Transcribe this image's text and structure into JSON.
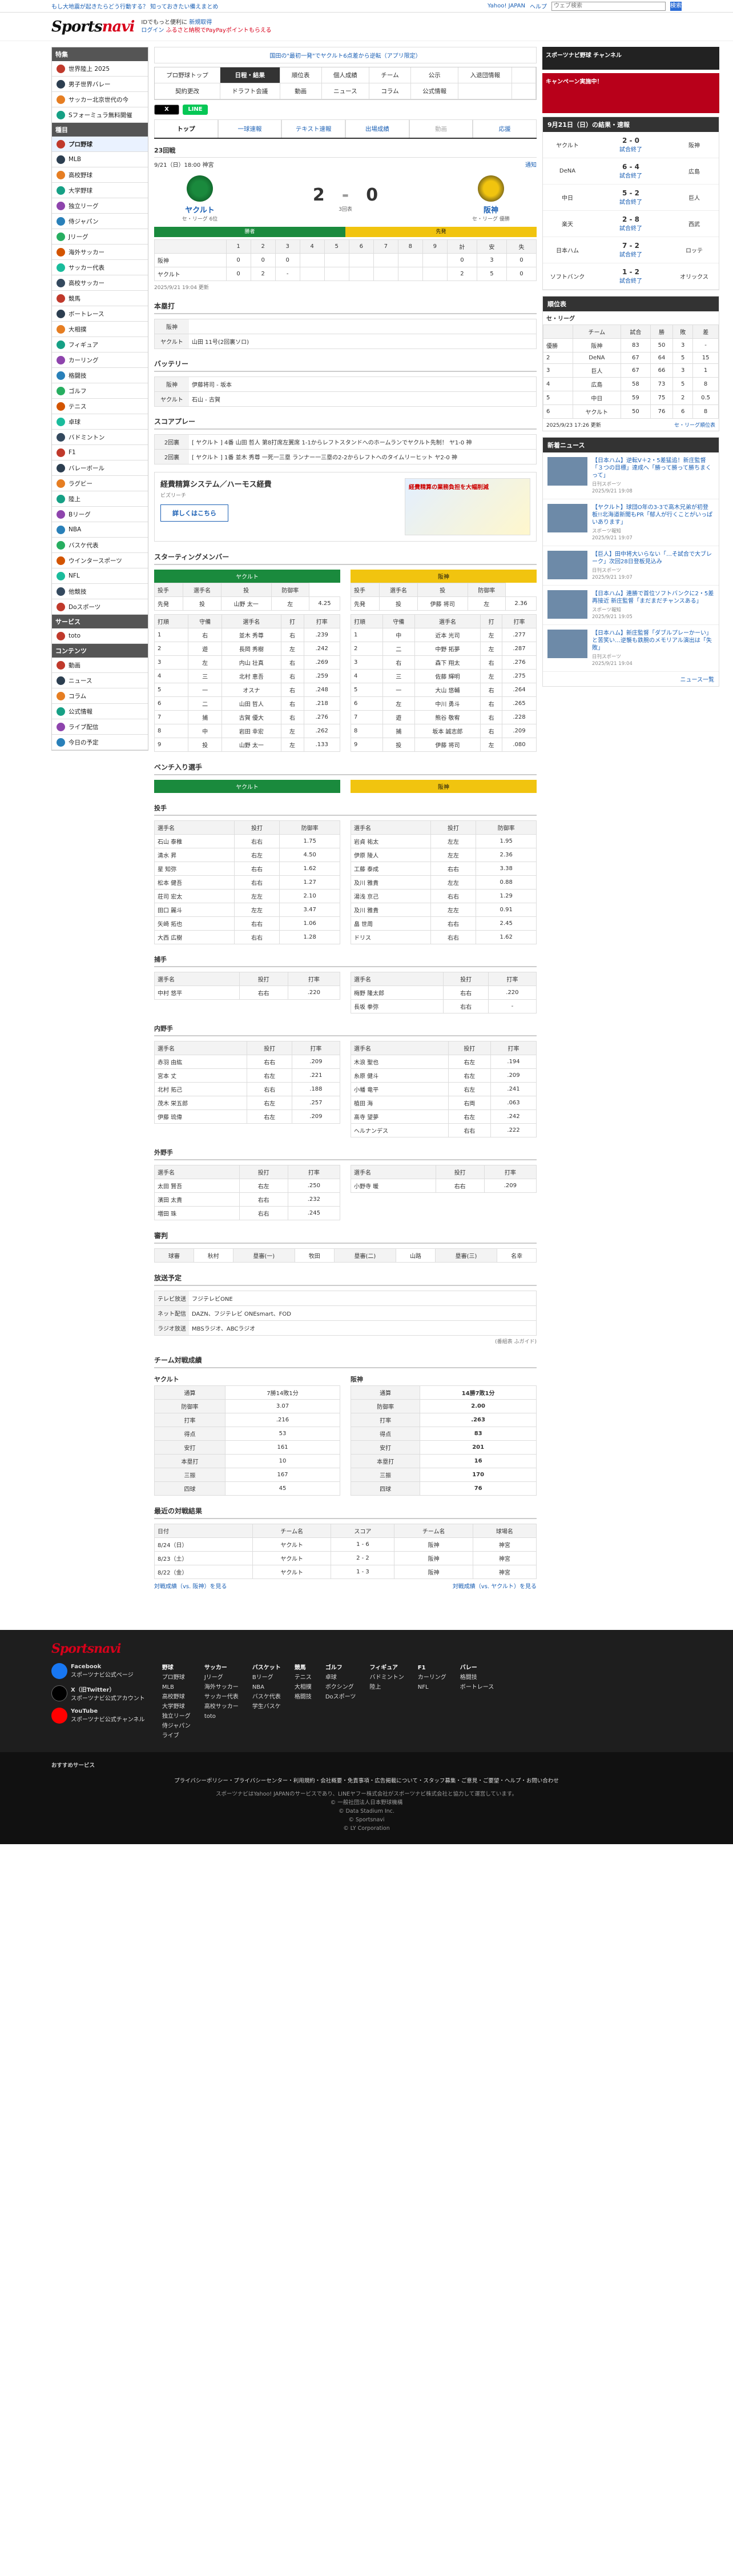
{
  "topbar": {
    "alert": "もし大地震が起きたらどう行動する？ 知っておきたい備えまとめ",
    "yahoo": "Yahoo! JAPAN",
    "help": "ヘルプ",
    "search_placeholder": "ウェブ検索",
    "search_btn": "検索"
  },
  "header": {
    "logo_a": "Sports",
    "logo_b": "navi",
    "line1a": "IDでもっと便利に",
    "line1b": "新規取得",
    "line2a": "ログイン",
    "line2b": "ふるさと納税でPayPayポイントもらえる"
  },
  "lnav": {
    "special": "特集",
    "sp_items": [
      "世界陸上 2025",
      "男子世界バレー",
      "サッカー北京世代の今",
      "Sフォーミュラ無料開催"
    ],
    "sport": "種目",
    "items": [
      "プロ野球",
      "MLB",
      "高校野球",
      "大学野球",
      "独立リーグ",
      "侍ジャパン",
      "Jリーグ",
      "海外サッカー",
      "サッカー代表",
      "高校サッカー",
      "競馬",
      "ボートレース",
      "大相撲",
      "フィギュア",
      "カーリング",
      "格闘技",
      "ゴルフ",
      "テニス",
      "卓球",
      "バドミントン",
      "F1",
      "バレーボール",
      "ラグビー",
      "陸上",
      "Bリーグ",
      "NBA",
      "バスケ代表",
      "ウインタースポーツ",
      "NFL",
      "他競技",
      "Doスポーツ"
    ],
    "service": "サービス",
    "svc_items": [
      "toto"
    ],
    "content": "コンテンツ",
    "cnt_items": [
      "動画",
      "ニュース",
      "コラム",
      "公式情報",
      "ライブ配信",
      "今日の予定"
    ]
  },
  "crumb": "国田の\"最初一発\"でヤクルト6点差から逆転（アプリ限定）",
  "subnav": [
    "プロ野球トップ",
    "日程・結果",
    "順位表",
    "個人成績",
    "チーム",
    "公示",
    "入退団情報",
    "",
    "契約更改",
    "ドラフト会議",
    "動画",
    "ニュース",
    "コラム",
    "公式情報",
    "",
    ""
  ],
  "share": [
    "X",
    "LINE"
  ],
  "gametabs": [
    "トップ",
    "一球速報",
    "テキスト速報",
    "出場成績",
    "動画",
    "応援"
  ],
  "game": {
    "round": "23回戦",
    "date": "9/21（日）18:00 神宮",
    "notify": "通知",
    "home": "ヤクルト",
    "home_sub": "セ・リーグ 6位",
    "away": "阪神",
    "away_sub": "セ・リーグ 優勝",
    "hs": "2",
    "as": "0",
    "phase": "試合終了",
    "result": "3回表",
    "win": "勝者",
    "lose": "先発",
    "lineH": [
      "",
      "1",
      "2",
      "3",
      "4",
      "5",
      "6",
      "7",
      "8",
      "9",
      "計",
      "安",
      "失"
    ],
    "lineA": [
      "阪神",
      "0",
      "0",
      "0",
      "",
      "",
      "",
      "",
      "",
      "",
      "0",
      "3",
      "0"
    ],
    "lineY": [
      "ヤクルト",
      "0",
      "2",
      "-",
      "",
      "",
      "",
      "",
      "",
      "",
      "2",
      "5",
      "0"
    ],
    "updated": "2025/9/21 19:04 更新"
  },
  "hr": {
    "title": "本塁打",
    "rows": [
      {
        "t": "阪神",
        "v": ""
      },
      {
        "t": "ヤクルト",
        "v": "山田 11号(2回裏ソロ)"
      }
    ]
  },
  "battery": {
    "title": "バッテリー",
    "rows": [
      {
        "t": "阪神",
        "v": "伊藤将司 - 坂本"
      },
      {
        "t": "ヤクルト",
        "v": "石山 - 古賀"
      }
    ]
  },
  "scoreplay": {
    "title": "スコアプレー",
    "rows": [
      {
        "t": "2回裏",
        "v": "[ ヤクルト ] 4番 山田 哲人 第8打席左翼席 1-1からレフトスタンドへのホームランでヤクルト先制！ ヤ1-0 神"
      },
      {
        "t": "2回裏",
        "v": "[ ヤクルト ] 1番 並木 秀尊 一死一三塁 ランナー一三塁の2-2からレフトへのタイムリーヒット ヤ2-0 神"
      }
    ]
  },
  "ad": {
    "title": "経費精算システム／ハーモス経費",
    "sub": "ビズリーチ",
    "btn": "詳しくはこちら",
    "img": "経費精算の業務負担を大幅削減"
  },
  "starting": {
    "title": "スターティングメンバー",
    "yakult": "ヤクルト",
    "hanshin": "阪神",
    "ph": [
      "投手",
      "選手名",
      "投",
      "防御率"
    ],
    "yp": [
      "先発",
      "投",
      "山野 太一",
      "左",
      "4.25"
    ],
    "hp": [
      "先発",
      "投",
      "伊藤 将司",
      "左",
      "2.36"
    ],
    "bh": [
      "打順",
      "守備",
      "選手名",
      "打",
      "打率"
    ],
    "yb": [
      [
        "1",
        "右",
        "並木 秀尊",
        "右",
        ".239"
      ],
      [
        "2",
        "遊",
        "長岡 秀樹",
        "左",
        ".242"
      ],
      [
        "3",
        "左",
        "内山 壮真",
        "右",
        ".269"
      ],
      [
        "4",
        "三",
        "北村 恵吾",
        "右",
        ".259"
      ],
      [
        "5",
        "一",
        "オスナ",
        "右",
        ".248"
      ],
      [
        "6",
        "二",
        "山田 哲人",
        "右",
        ".218"
      ],
      [
        "7",
        "捕",
        "古賀 優大",
        "右",
        ".276"
      ],
      [
        "8",
        "中",
        "岩田 幸宏",
        "左",
        ".262"
      ],
      [
        "9",
        "投",
        "山野 太一",
        "左",
        ".133"
      ]
    ],
    "hb": [
      [
        "1",
        "中",
        "近本 光司",
        "左",
        ".277"
      ],
      [
        "2",
        "二",
        "中野 拓夢",
        "左",
        ".287"
      ],
      [
        "3",
        "右",
        "森下 翔太",
        "右",
        ".276"
      ],
      [
        "4",
        "三",
        "佐藤 輝明",
        "左",
        ".275"
      ],
      [
        "5",
        "一",
        "大山 悠輔",
        "右",
        ".264"
      ],
      [
        "6",
        "左",
        "中川 勇斗",
        "右",
        ".265"
      ],
      [
        "7",
        "遊",
        "熊谷 敬宥",
        "右",
        ".228"
      ],
      [
        "8",
        "捕",
        "坂本 誠志郎",
        "右",
        ".209"
      ],
      [
        "9",
        "投",
        "伊藤 将司",
        "左",
        ".080"
      ]
    ]
  },
  "bench": {
    "title": "ベンチ入り選手",
    "pitch": "投手",
    "catch": "捕手",
    "inf": "内野手",
    "outf": "外野手",
    "ph": [
      "選手名",
      "投打",
      "防御率"
    ],
    "bh": [
      "選手名",
      "投打",
      "打率"
    ],
    "yp": [
      [
        "石山 泰稚",
        "右右",
        "1.75"
      ],
      [
        "清水 昇",
        "右左",
        "4.50"
      ],
      [
        "星 知弥",
        "右右",
        "1.62"
      ],
      [
        "松本 健吾",
        "右右",
        "1.27"
      ],
      [
        "荘司 宏太",
        "左左",
        "2.10"
      ],
      [
        "田口 麗斗",
        "左左",
        "3.47"
      ],
      [
        "矢崎 拓也",
        "右右",
        "1.06"
      ],
      [
        "大西 広樹",
        "右右",
        "1.28"
      ]
    ],
    "hp": [
      [
        "岩貞 祐太",
        "左左",
        "1.95"
      ],
      [
        "伊原 陵人",
        "左左",
        "2.36"
      ],
      [
        "工藤 泰成",
        "右右",
        "3.38"
      ],
      [
        "及川 雅貴",
        "左左",
        "0.88"
      ],
      [
        "湯浅 京己",
        "右右",
        "1.29"
      ],
      [
        "及川 雅貴",
        "左左",
        "0.91"
      ],
      [
        "畠 世周",
        "右右",
        "2.45"
      ],
      [
        "ドリス",
        "右右",
        "1.62"
      ]
    ],
    "yc": [
      [
        "中村 悠平",
        "右右",
        ".220"
      ]
    ],
    "hc": [
      [
        "梅野 隆太郎",
        "右右",
        ".220"
      ],
      [
        "長坂 拳弥",
        "右右",
        "-"
      ]
    ],
    "yi": [
      [
        "赤羽 由紘",
        "右右",
        ".209"
      ],
      [
        "宮本 丈",
        "右左",
        ".221"
      ],
      [
        "北村 拓己",
        "右右",
        ".188"
      ],
      [
        "茂木 栄五郎",
        "右左",
        ".257"
      ],
      [
        "伊藤 琉偉",
        "右左",
        ".209"
      ]
    ],
    "hi": [
      [
        "木浪 聖也",
        "右左",
        ".194"
      ],
      [
        "糸原 健斗",
        "右左",
        ".209"
      ],
      [
        "小幡 竜平",
        "右左",
        ".241"
      ],
      [
        "植田 海",
        "右両",
        ".063"
      ],
      [
        "髙寺 望夢",
        "右左",
        ".242"
      ],
      [
        "ヘルナンデス",
        "右右",
        ".222"
      ]
    ],
    "yo": [
      [
        "太田 賢吾",
        "右左",
        ".250"
      ],
      [
        "濱田 太貴",
        "右右",
        ".232"
      ],
      [
        "増田 珠",
        "右右",
        ".245"
      ]
    ],
    "ho": [
      [
        "小野寺 暖",
        "右右",
        ".209"
      ]
    ]
  },
  "umpires": {
    "title": "審判",
    "cells": [
      "球審",
      "秋村",
      "塁審(一)",
      "牧田",
      "塁審(二)",
      "山路",
      "塁審(三)",
      "名幸"
    ]
  },
  "broadcast": {
    "title": "放送予定",
    "rows": [
      {
        "t": "テレビ放送",
        "v": "フジテレビONE"
      },
      {
        "t": "ネット配信",
        "v": "DAZN、フジテレビ ONEsmart、FOD"
      },
      {
        "t": "ラジオ放送",
        "v": "MBSラジオ、ABCラジオ"
      }
    ],
    "note": "(番組表 ふガイド)"
  },
  "teamstats": {
    "title": "チーム対戦成績",
    "yakult": "ヤクルト",
    "hanshin": "阪神",
    "rows": [
      [
        "通算",
        "7勝14敗1分",
        "14勝7敗1分"
      ],
      [
        "防御率",
        "3.07",
        "2.00"
      ],
      [
        "打率",
        ".216",
        ".263"
      ],
      [
        "得点",
        "53",
        "83"
      ],
      [
        "安打",
        "161",
        "201"
      ],
      [
        "本塁打",
        "10",
        "16"
      ],
      [
        "三振",
        "167",
        "170"
      ],
      [
        "四球",
        "45",
        "76"
      ]
    ]
  },
  "recent": {
    "title": "最近の対戦結果",
    "hd": [
      "日付",
      "チーム名",
      "スコア",
      "チーム名",
      "球場名"
    ],
    "rows": [
      [
        "8/24（日）",
        "ヤクルト",
        "1 - 6",
        "阪神",
        "神宮"
      ],
      [
        "8/23（土）",
        "ヤクルト",
        "2 - 2",
        "阪神",
        "神宮"
      ],
      [
        "8/22（金）",
        "ヤクルト",
        "1 - 3",
        "阪神",
        "神宮"
      ]
    ],
    "more": "対戦成績（vs. 阪神）を見る",
    "more2": "対戦成績（vs. ヤクルト）を見る"
  },
  "side": {
    "ban1": "スポーツナビ野球 チャンネル",
    "ban2": "キャンペーン実施中！",
    "today": "9月21日（日）の結果・速報",
    "games": [
      [
        "ヤクルト",
        "2 - 0",
        "阪神",
        "試合終了"
      ],
      [
        "DeNA",
        "6 - 4",
        "広島",
        "試合終了"
      ],
      [
        "中日",
        "5 - 2",
        "巨人",
        "試合終了"
      ],
      [
        "楽天",
        "2 - 8",
        "西武",
        "試合終了"
      ],
      [
        "日本ハム",
        "7 - 2",
        "ロッテ",
        "試合終了"
      ],
      [
        "ソフトバンク",
        "1 - 2",
        "オリックス",
        "試合終了"
      ]
    ],
    "stand": "順位表",
    "league": "セ・リーグ",
    "sh": [
      "",
      "チーム",
      "試合",
      "勝",
      "敗",
      "差"
    ],
    "srows": [
      [
        "優勝",
        "阪神",
        "83",
        "50",
        "3",
        "-"
      ],
      [
        "2",
        "DeNA",
        "67",
        "64",
        "5",
        "15"
      ],
      [
        "3",
        "巨人",
        "67",
        "66",
        "3",
        "1"
      ],
      [
        "4",
        "広島",
        "58",
        "73",
        "5",
        "8"
      ],
      [
        "5",
        "中日",
        "59",
        "75",
        "2",
        "0.5"
      ],
      [
        "6",
        "ヤクルト",
        "50",
        "76",
        "6",
        "8"
      ]
    ],
    "supd": "2025/9/23 17:26 更新",
    "smore": "セ・リーグ順位表",
    "nhead": "新着ニュース",
    "news": [
      [
        "【日本ハム】逆転V＋2・5差猛追！新庄監督「３つの目標」達成へ「勝って勝って勝ちまくって」",
        "日刊スポーツ",
        "2025/9/21 19:08"
      ],
      [
        "【ヤクルト】球団O年の3-3で高木兄弟が初登板!!北海道新聞もPR「郁人が行くことがいっぱいあります」",
        "スポーツ報知",
        "2025/9/21 19:07"
      ],
      [
        "【巨人】田中将大いらない「…そ試合で大ブレーク」次回28日登板見込み",
        "日刊スポーツ",
        "2025/9/21 19:07"
      ],
      [
        "【日本ハム】連勝で首位ソフトバンクに2・5差再接近 新庄監督「まだまだチャンスある」",
        "スポーツ報知",
        "2025/9/21 19:05"
      ],
      [
        "【日本ハム】新庄監督「ダブルプレーかーい」と苦笑い…逆襲も鉄腕のメモリアル演出は「失敗」",
        "日刊スポーツ",
        "2025/9/21 19:04"
      ]
    ],
    "nmore": "ニュース一覧"
  },
  "footer": {
    "fb": "Facebook",
    "fb2": "スポーツナビ公式ページ",
    "x": "X（旧Twitter）",
    "x2": "スポーツナビ公式アカウント",
    "yt": "YouTube",
    "yt2": "スポーツナビ公式チャンネル",
    "cols": [
      [
        "野球",
        "プロ野球",
        "MLB",
        "高校野球",
        "大学野球",
        "独立リーグ",
        "侍ジャパン",
        "ライブ"
      ],
      [
        "サッカー",
        "Jリーグ",
        "海外サッカー",
        "サッカー代表",
        "高校サッカー",
        "toto"
      ],
      [
        "バスケット",
        "Bリーグ",
        "NBA",
        "バスケ代表",
        "学生バスケ"
      ],
      [
        "競馬",
        "テニス",
        "大相撲",
        "格闘技"
      ],
      [
        "ゴルフ",
        "卓球",
        "ボクシング",
        "Doスポーツ"
      ],
      [
        "フィギュア",
        "バドミントン",
        "陸上"
      ],
      [
        "F1",
        "カーリング",
        "NFL"
      ],
      [
        "バレー",
        "格闘技",
        "ボートレース"
      ]
    ],
    "rec": "おすすめサービス",
    "links": "プライバシーポリシー・プライバシーセンター・利用規約・会社概要・免責事項・広告掲載について・スタッフ募集・ご意見・ご要望・ヘルプ・お問い合わせ",
    "credit": "スポーツナビはYahoo! JAPANのサービスであり、LINEヤフー株式会社がスポーツナビ株式会社と協力して運営しています。",
    "copy1": "© 一般社団法人日本野球機構",
    "copy2": "© Data Stadium Inc.",
    "copy3": "© Sportsnavi",
    "copy4": "© LY Corporation"
  }
}
